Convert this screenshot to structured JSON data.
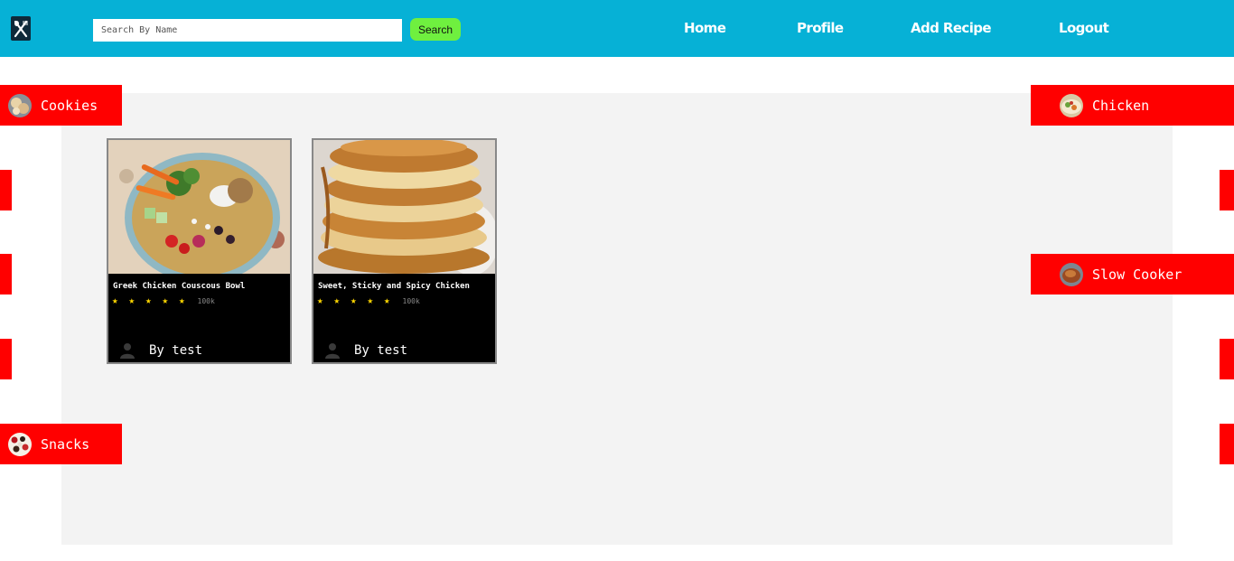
{
  "header": {
    "logo_icon": "spoon-fork-icon",
    "search": {
      "placeholder": "Search By Name",
      "value": "",
      "button_label": "Search"
    },
    "nav": [
      {
        "label": "Home"
      },
      {
        "label": "Profile"
      },
      {
        "label": "Add Recipe"
      },
      {
        "label": "Logout"
      }
    ]
  },
  "colors": {
    "header_bg": "#06b1d6",
    "search_button": "#6ff03f",
    "category_bg": "#ff0000",
    "panel_bg": "#f3f3f3",
    "card_bg": "#000000",
    "star": "#ffd700"
  },
  "categories": {
    "left": [
      {
        "label": "Cookies",
        "icon": "cookies-thumbnail"
      },
      {
        "label": "Snacks",
        "icon": "snacks-thumbnail"
      }
    ],
    "right": [
      {
        "label": "Chicken",
        "icon": "chicken-thumbnail"
      },
      {
        "label": "Slow Cooker",
        "icon": "slow-cooker-thumbnail"
      }
    ]
  },
  "recipes": [
    {
      "title": "Greek Chicken Couscous Bowl",
      "rating": 5,
      "count": "100k",
      "author": "By test",
      "image": "couscous-bowl-photo"
    },
    {
      "title": "Sweet, Sticky and Spicy Chicken",
      "rating": 5,
      "count": "100k",
      "author": "By test",
      "image": "pancake-stack-photo"
    }
  ]
}
